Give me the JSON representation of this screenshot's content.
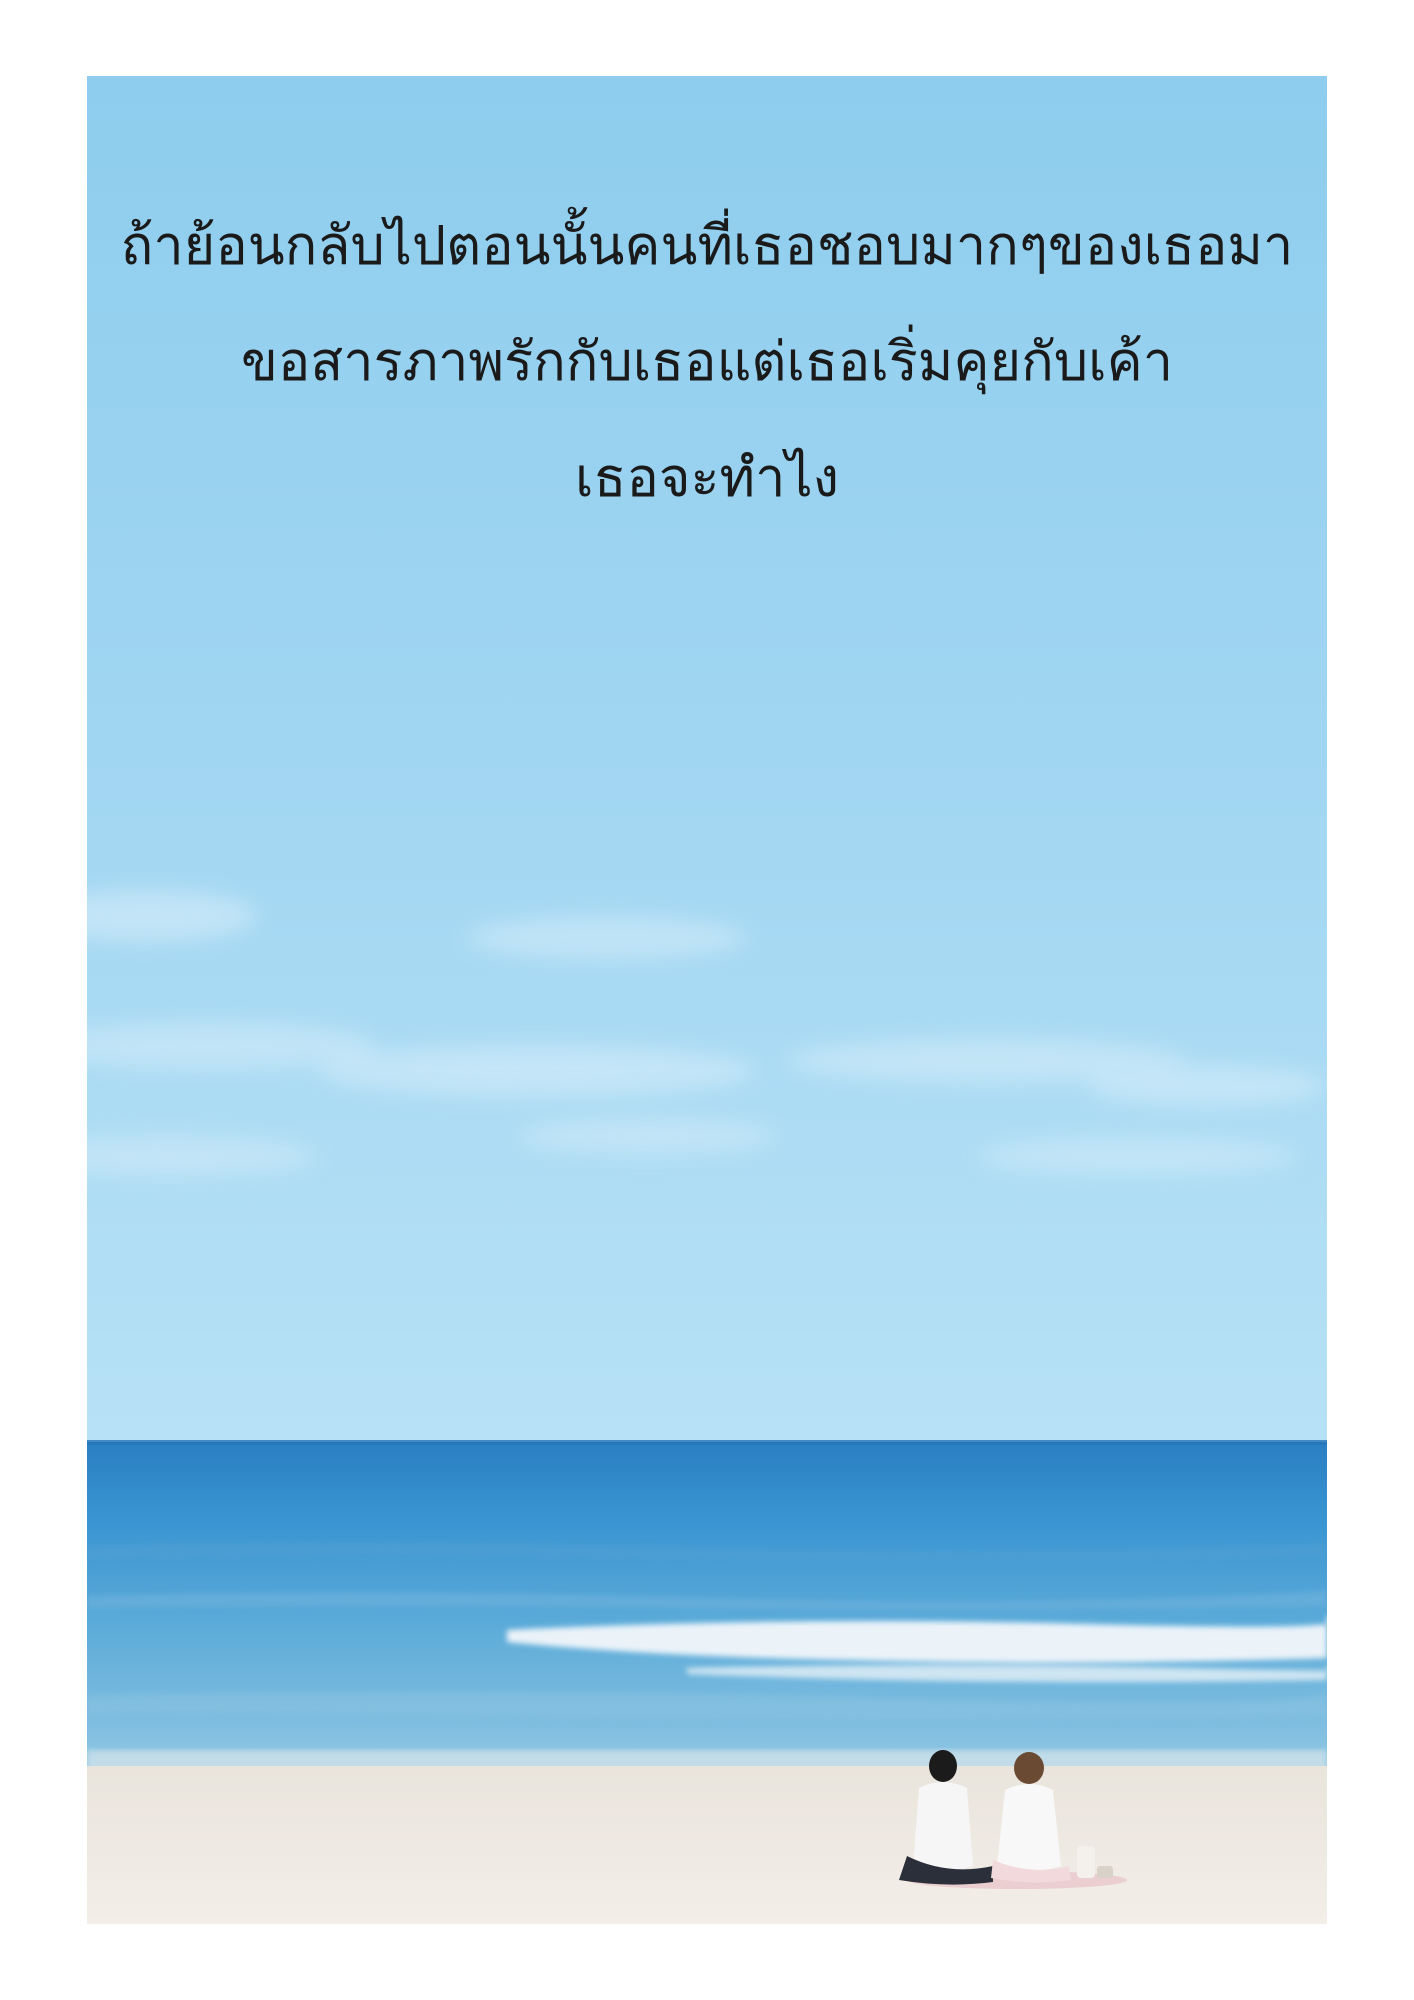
{
  "caption": {
    "lines": [
      "ถ้าย้อนกลับไปตอนนั้นคนที่เธอชอบมากๆของเธอมา",
      "ขอสารภาพรักกับเธอแต่เธอเริ่มคุยกับเค้า",
      "เธอจะทำไง"
    ]
  },
  "colors": {
    "sky_top": "#8fcdee",
    "sky_bottom": "#b3dff5",
    "sea_horizon": "#2f86c8",
    "sea_near": "#6db1d8",
    "foam": "#f4f8fb",
    "sand": "#efe9e1"
  }
}
